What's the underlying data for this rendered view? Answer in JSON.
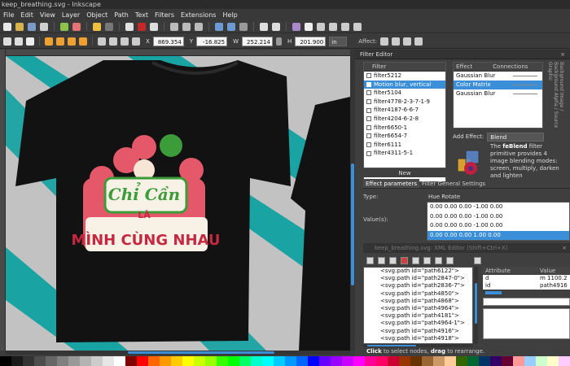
{
  "window": {
    "title": "keep_breathing.svg - Inkscape"
  },
  "menu": [
    "File",
    "Edit",
    "View",
    "Layer",
    "Object",
    "Path",
    "Text",
    "Filters",
    "Extensions",
    "Help"
  ],
  "coords": {
    "x_label": "X",
    "x_value": "869.354",
    "y_label": "Y",
    "y_value": "-16.825",
    "w_label": "W",
    "w_value": "252.214",
    "h_label": "H",
    "h_value": "201.900",
    "unit": "in",
    "affect_label": "Affect:"
  },
  "canvas": {
    "background_color": "#c2c2c2",
    "stripe_color": "#1aa3a3",
    "shirt_color": "#121212",
    "design_text": [
      "Chỉ Cần",
      "LÀ",
      "MÌNH CÙNG NHAU"
    ]
  },
  "filter_editor": {
    "title": "Filter Editor",
    "filter_column_header": "Filter",
    "filters": [
      "filter5212",
      "Motion blur, vertical",
      "filter5104",
      "filter4778-2-3-7-1-9",
      "filter4187-6-6-7",
      "filter4204-6-2-8",
      "filter6650-1",
      "filter6654-7",
      "filter6111",
      "filter4311-5-1"
    ],
    "selected_filter_index": 1,
    "new_button": "New",
    "effect_header": "Effect",
    "connections_header": "Connections",
    "effects": [
      "Gaussian Blur",
      "Color Matrix",
      "Gaussian Blur"
    ],
    "selected_effect_index": 1,
    "side_tabs": "Background Image / Background Alpha / Source Graphic",
    "add_effect_label": "Add Effect:",
    "add_effect_value": "Blend",
    "blend_desc_bold": "feBlend",
    "blend_desc_pre": "The ",
    "blend_desc_post": " filter primitive provides 4 image blending modes: screen, multiply, darken and lighten",
    "tab_params": "Effect parameters",
    "tab_general": "Filter General Settings",
    "type_label": "Type:",
    "type_value": "Hue Rotate",
    "values_label": "Value(s):",
    "matrix_rows": [
      "0.00  0.00  0.00  -1.00  0.00",
      "0.00  0.00  0.00  -1.00  0.00",
      "0.00  0.00  0.00  -1.00  0.00",
      "0.00  0.00  0.00  1.00  0.00"
    ],
    "selected_matrix_row": 3
  },
  "xml_editor": {
    "title": "keep_breathing.svg: XML Editor (Shift+Ctrl+X)",
    "nodes": [
      "<svg:path id=\"path6122\">",
      "<svg:path id=\"path2847-0\">",
      "<svg:path id=\"path2836-7\">",
      "<svg:path id=\"path4850\">",
      "<svg:path id=\"path4868\">",
      "<svg:path id=\"path4964\">",
      "<svg:path id=\"path4181\">",
      "<svg:path id=\"path4964-1\">",
      "<svg:path id=\"path4916\">",
      "<svg:path id=\"path4918\">"
    ],
    "attr_header": "Attribute",
    "value_header": "Value",
    "attrs": [
      {
        "name": "d",
        "value": "m 1100.2"
      },
      {
        "name": "id",
        "value": "path4916"
      }
    ],
    "status_click": "Click",
    "status_mid": " to select nodes, ",
    "status_drag": "drag",
    "status_end": " to rearrange."
  },
  "palette": [
    "#000000",
    "#1a1a1a",
    "#333333",
    "#4d4d4d",
    "#666666",
    "#808080",
    "#999999",
    "#b3b3b3",
    "#cccccc",
    "#e6e6e6",
    "#ffffff",
    "#800000",
    "#ff0000",
    "#ff6600",
    "#ff9900",
    "#ffcc00",
    "#ffff00",
    "#ccff00",
    "#99ff00",
    "#33ff00",
    "#00ff00",
    "#00ff66",
    "#00ffcc",
    "#00ffff",
    "#00ccff",
    "#0099ff",
    "#0066ff",
    "#0000ff",
    "#6600ff",
    "#9900ff",
    "#cc00ff",
    "#ff00ff",
    "#ff0099",
    "#ff0066",
    "#cc0033",
    "#993300",
    "#663300",
    "#996633",
    "#cc9966",
    "#ffcc99",
    "#336600",
    "#006633",
    "#003366",
    "#330066",
    "#660033",
    "#ff9999",
    "#99ccff",
    "#ccffcc",
    "#ffffcc",
    "#ffccff"
  ]
}
